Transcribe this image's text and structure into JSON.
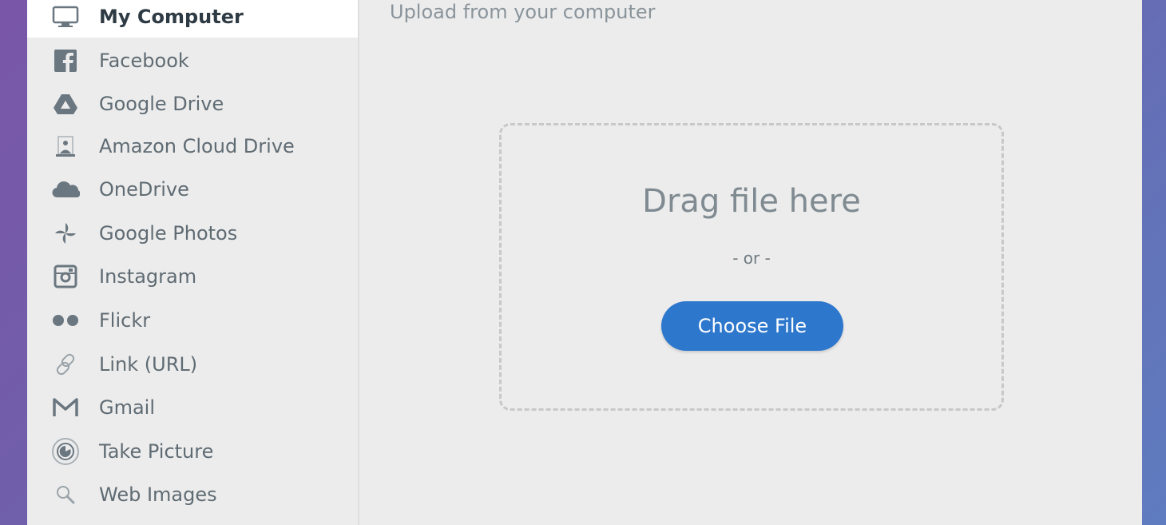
{
  "sidebar": {
    "items": [
      {
        "label": "My Computer",
        "icon": "monitor-icon",
        "active": true
      },
      {
        "label": "Facebook",
        "icon": "facebook-icon"
      },
      {
        "label": "Google Drive",
        "icon": "google-drive-icon"
      },
      {
        "label": "Amazon Cloud Drive",
        "icon": "amazon-cloud-drive-icon"
      },
      {
        "label": "OneDrive",
        "icon": "onedrive-icon"
      },
      {
        "label": "Google Photos",
        "icon": "google-photos-icon"
      },
      {
        "label": "Instagram",
        "icon": "instagram-icon"
      },
      {
        "label": "Flickr",
        "icon": "flickr-icon"
      },
      {
        "label": "Link (URL)",
        "icon": "link-icon"
      },
      {
        "label": "Gmail",
        "icon": "gmail-icon"
      },
      {
        "label": "Take Picture",
        "icon": "camera-icon"
      },
      {
        "label": "Web Images",
        "icon": "search-icon"
      }
    ]
  },
  "content": {
    "title": "Upload from your computer",
    "drop_title": "Drag file here",
    "or_text": "- or -",
    "choose_button": "Choose File"
  },
  "colors": {
    "accent": "#2d77cd",
    "icon": "#6b7780",
    "background_gradient_start": "#7a56a8",
    "background_gradient_end": "#5f7cc0"
  }
}
